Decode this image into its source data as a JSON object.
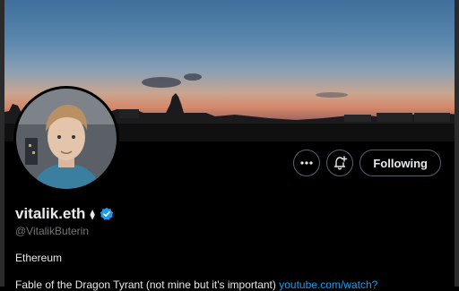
{
  "profile": {
    "display_name": "vitalik.eth",
    "name_badge": "⧫",
    "handle": "@VitalikButerin",
    "bio": "Ethereum",
    "bio_line2": "Fable of the Dragon Tyrant (not mine but it's important)",
    "bio_link": "youtube.com/watch?",
    "verified_icon": "verified-badge-icon"
  },
  "actions": {
    "more_icon": "more-horizontal-icon",
    "notify_icon": "bell-plus-icon",
    "follow_label": "Following"
  },
  "colors": {
    "background": "#000000",
    "text": "#e7e9ea",
    "muted": "#71767b",
    "verified": "#1d9bf0",
    "button_border": "#536471"
  }
}
